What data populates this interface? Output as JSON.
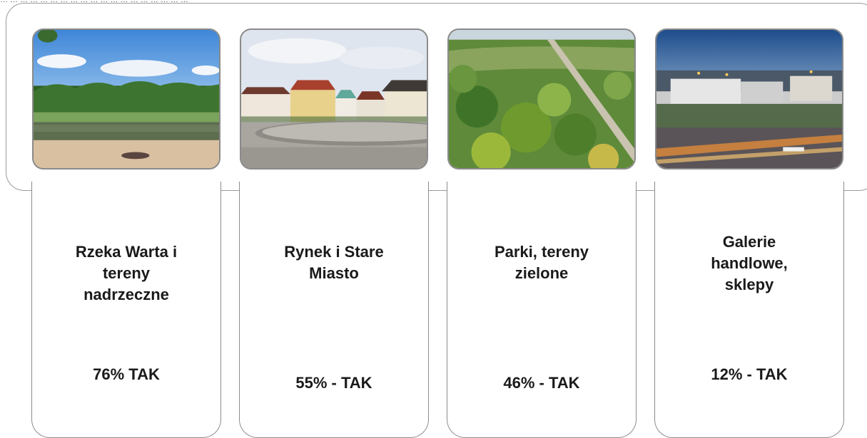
{
  "top_caption": "… … … … … … … … … … … … … … … … … … …",
  "cards": [
    {
      "title_lines": [
        "Rzeka Warta i",
        "tereny",
        "nadrzeczne"
      ],
      "stat": "76% TAK",
      "photo": "river-photo"
    },
    {
      "title_lines": [
        "Rynek i Stare",
        "Miasto"
      ],
      "stat": "55% - TAK",
      "photo": "market-square-photo"
    },
    {
      "title_lines": [
        "Parki, tereny",
        "zielone"
      ],
      "stat": "46% - TAK",
      "photo": "parks-photo"
    },
    {
      "title_lines": [
        "Galerie",
        "handlowe,",
        "sklepy"
      ],
      "stat": "12% - TAK",
      "photo": "shopping-center-photo"
    }
  ]
}
